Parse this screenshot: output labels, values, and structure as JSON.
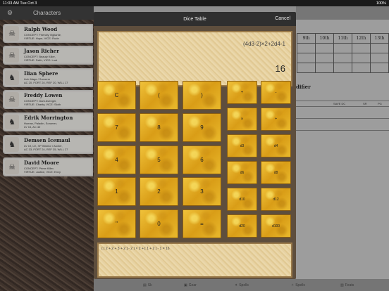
{
  "status": {
    "time": "11:03 AM",
    "date": "Tue Oct 3",
    "battery": "100%"
  },
  "sidebar": {
    "title": "Characters",
    "characters": [
      {
        "name": "Ralph Wood",
        "line1": "CONCEPT: Friendly Vigilante,",
        "line2": "VIRTUE: Hope, VICE: Rude"
      },
      {
        "name": "Jason Richer",
        "line1": "CONCEPT: Beauty Killer,",
        "line2": "VIRTUE: Faith, VICE: Lust"
      },
      {
        "name": "Ilian Sphere",
        "line1": "Lich Mage / Sorcerer",
        "line2": "AC 20, FORT 24, REF 20, WILL 17"
      },
      {
        "name": "Freddy Lowen",
        "line1": "CONCEPT: Dark Avenger,",
        "line2": "VIRTUE: Charity, VICE: Sloth"
      },
      {
        "name": "Edrik Morrington",
        "line1": "Human, Paladin, Sorcerer,",
        "line2": "LV 15, AC 40"
      },
      {
        "name": "Demsen Icemaul",
        "line1": "LV 19, LE, XP Warrior / Archer,",
        "line2": "AC 33, FORT 24, REF 35, WILL 27"
      },
      {
        "name": "David Moore",
        "line1": "CONCEPT: Prime Killer,",
        "line2": "VIRTUE: Justice, VICE: Envy"
      }
    ]
  },
  "sheet": {
    "level_headers": [
      "9th",
      "10th",
      "11th",
      "12th",
      "13th"
    ],
    "modifier_heading": "difier",
    "save_columns": [
      "SAVE DC",
      "SR",
      "PG"
    ]
  },
  "dice_table": {
    "title": "Dice Table",
    "cancel_label": "Cancel",
    "expression": "(4d3-2)×2+2d4-1",
    "result": "16",
    "keys": {
      "clear": "C",
      "open_paren": "(",
      "close_paren": ")",
      "seven": "7",
      "eight": "8",
      "nine": "9",
      "four": "4",
      "five": "5",
      "six": "6",
      "one": "1",
      "two": "2",
      "three": "3",
      "repeat": "\"",
      "zero": "0",
      "equals": "=",
      "plus": "+",
      "minus": "-",
      "times": "×",
      "divide": "÷"
    },
    "dice": [
      "d3",
      "d4",
      "d6",
      "d8",
      "d10",
      "d12",
      "d20",
      "d100"
    ],
    "breakdown": "( [ 2 + 2 + 3 + 2 ] - 2 ) × 2 + [ 1 + 2 ] - 1 = 16"
  },
  "tabbar": [
    "Sk",
    "Gear",
    "Spells",
    "Spells",
    "Feats"
  ]
}
